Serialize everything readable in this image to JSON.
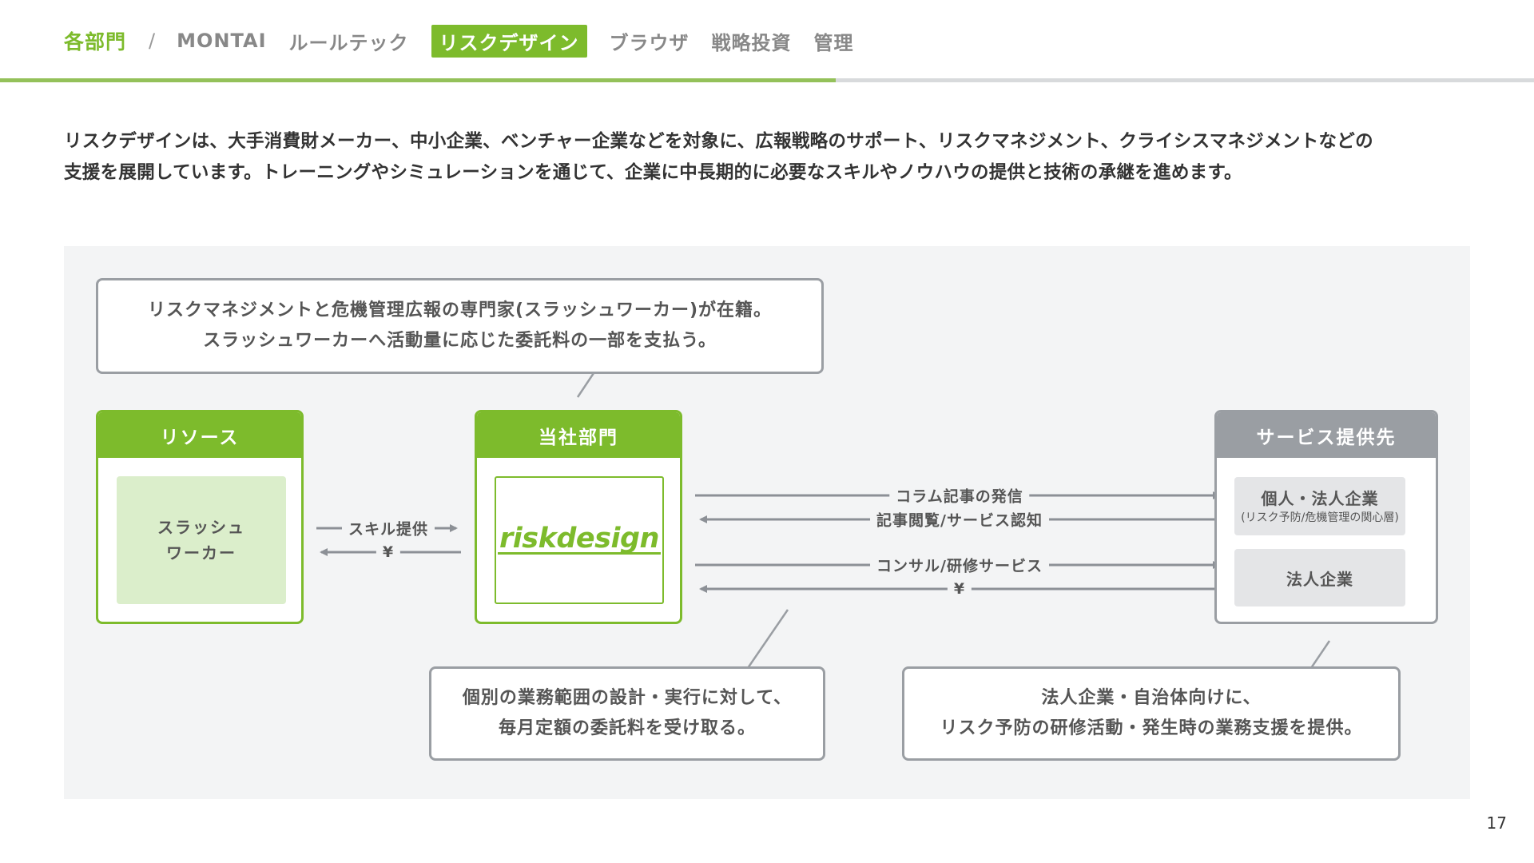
{
  "nav": {
    "root": "各部門",
    "separator": "/",
    "items": [
      "MONTAI",
      "ルールテック",
      "リスクデザイン",
      "ブラウザ",
      "戦略投資",
      "管理"
    ],
    "active_index": 2,
    "progress_fraction": 0.545
  },
  "intro": {
    "line1": "リスクデザインは、大手消費財メーカー、中小企業、ベンチャー企業などを対象に、広報戦略のサポート、リスクマネジメント、クライシスマネジメントなどの",
    "line2": "支援を展開しています。トレーニングやシミュレーションを通じて、企業に中長期的に必要なスキルやノウハウの提供と技術の承継を進めます。"
  },
  "diagram": {
    "bubble_top": {
      "line1": "リスクマネジメントと危機管理広報の専門家(スラッシュワーカー)が在籍。",
      "line2": "スラッシュワーカーへ活動量に応じた委託料の一部を支払う。"
    },
    "bubble_bottom_left": {
      "line1": "個別の業務範囲の設計・実行に対して、",
      "line2": "毎月定額の委託料を受け取る。"
    },
    "bubble_bottom_right": {
      "line1": "法人企業・自治体向けに、",
      "line2": "リスク予防の研修活動・発生時の業務支援を提供。"
    },
    "resource": {
      "title": "リソース",
      "inner_line1": "スラッシュ",
      "inner_line2": "ワーカー"
    },
    "company": {
      "title": "当社部門",
      "logo": "riskdesign"
    },
    "clients": {
      "title": "サービス提供先",
      "item1": "個人・法人企業",
      "item1_sub": "(リスク予防/危機管理の関心層)",
      "item2": "法人企業"
    },
    "flows": {
      "skill": "スキル提供",
      "yen_left": "¥",
      "column": "コラム記事の発信",
      "reading": "記事閲覧/サービス認知",
      "consulting": "コンサル/研修サービス",
      "yen_right": "¥"
    },
    "colors": {
      "accent": "#7dbb2c",
      "gray": "#9a9ea3",
      "arrow": "#8c9096",
      "panel": "#f3f4f5"
    }
  },
  "page_number": "17"
}
